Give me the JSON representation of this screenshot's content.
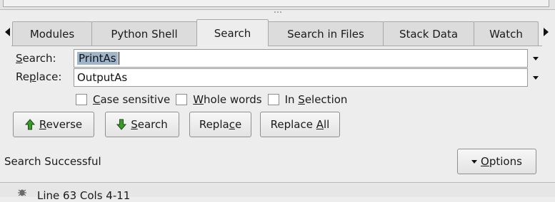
{
  "tabs": [
    {
      "label": "Modules"
    },
    {
      "label": "Python Shell"
    },
    {
      "label": "Search",
      "active": true
    },
    {
      "label": "Search in Files"
    },
    {
      "label": "Stack Data"
    },
    {
      "label": "Watch"
    }
  ],
  "search": {
    "label_pre": "",
    "label_ul": "S",
    "label_post": "earch:",
    "value": "PrintAs"
  },
  "replace": {
    "label_pre": "Re",
    "label_ul": "p",
    "label_post": "lace:",
    "value": "OutputAs"
  },
  "options": {
    "case_sensitive": {
      "ul": "C",
      "rest": "ase sensitive",
      "checked": false
    },
    "whole_words": {
      "ul": "W",
      "rest": "hole words",
      "checked": false
    },
    "in_selection": {
      "pre": "In ",
      "ul": "S",
      "rest": "election",
      "checked": false
    }
  },
  "buttons": {
    "reverse": {
      "ul": "R",
      "rest": "everse"
    },
    "search": {
      "ul": "S",
      "rest": "earch"
    },
    "replace": {
      "pre": "Repla",
      "ul": "c",
      "rest": "e"
    },
    "replace_all": {
      "pre": "Replace ",
      "ul": "A",
      "rest": "ll"
    },
    "options_menu": {
      "ul": "O",
      "rest": "ptions"
    }
  },
  "status_text": "Search Successful",
  "status_bar": {
    "position_text": "Line 63 Cols 4-11"
  },
  "colors": {
    "selection": "#9fb5c9",
    "icon_green": "#3a9a2a"
  },
  "icons": [
    "tab-scroll-left-icon",
    "tab-scroll-right-icon",
    "dropdown-arrow-icon",
    "arrow-up-icon",
    "arrow-down-icon",
    "bug-icon"
  ]
}
